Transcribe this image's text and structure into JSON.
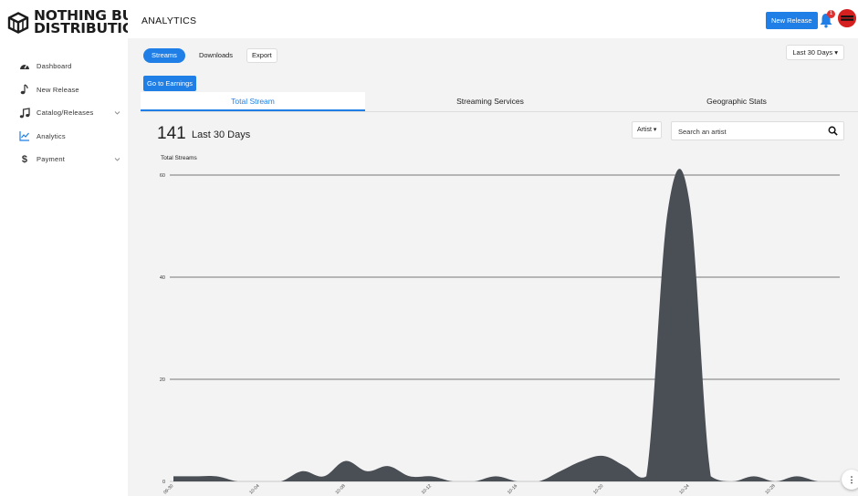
{
  "brand": {
    "line1": "NOTHING BUT",
    "line2": "DISTRIBUTION"
  },
  "sidebar": {
    "items": [
      {
        "label": "Dashboard",
        "icon": "gauge-icon",
        "has_chevron": false
      },
      {
        "label": "New Release",
        "icon": "music-note-icon",
        "has_chevron": false
      },
      {
        "label": "Catalog/Releases",
        "icon": "music-notes-icon",
        "has_chevron": true
      },
      {
        "label": "Analytics",
        "icon": "line-chart-icon",
        "has_chevron": false,
        "active": true
      },
      {
        "label": "Payment",
        "icon": "dollar-icon",
        "has_chevron": true
      }
    ]
  },
  "header": {
    "title": "ANALYTICS",
    "new_release_label": "New Release",
    "notification_count": "1"
  },
  "filters": {
    "tabs": [
      "Streams",
      "Downloads",
      "Export"
    ],
    "active_tab": "Streams",
    "range": "Last 30 Days ▾"
  },
  "earnings_button": "Go to Earnings",
  "section_tabs": [
    "Total Stream",
    "Streaming Services",
    "Geographic Stats"
  ],
  "summary": {
    "total": "141",
    "period": "Last 30 Days"
  },
  "artist_filter": "Artist ▾",
  "search": {
    "placeholder": "Search an artist",
    "value": ""
  },
  "colors": {
    "accent": "#1f7fe6",
    "area": "#4a4e55",
    "badge": "#e03232"
  },
  "chart_data": {
    "type": "area",
    "title": "",
    "ylabel": "Total Streams",
    "xlabel": "",
    "ylim": [
      0,
      60
    ],
    "yticks": [
      0,
      20,
      40,
      60
    ],
    "grid": true,
    "x_ticks": [
      "09-30",
      "10-04",
      "10-08",
      "10-12",
      "10-16",
      "10-20",
      "10-24",
      "10-28"
    ],
    "series": [
      {
        "values": [
          1,
          1,
          1,
          0,
          0,
          0,
          2,
          1,
          4,
          2,
          3,
          1,
          1,
          0,
          0,
          1,
          0,
          0,
          2,
          4,
          5,
          3,
          1,
          53,
          55,
          1,
          0,
          1,
          0,
          1,
          0,
          0
        ]
      }
    ]
  }
}
